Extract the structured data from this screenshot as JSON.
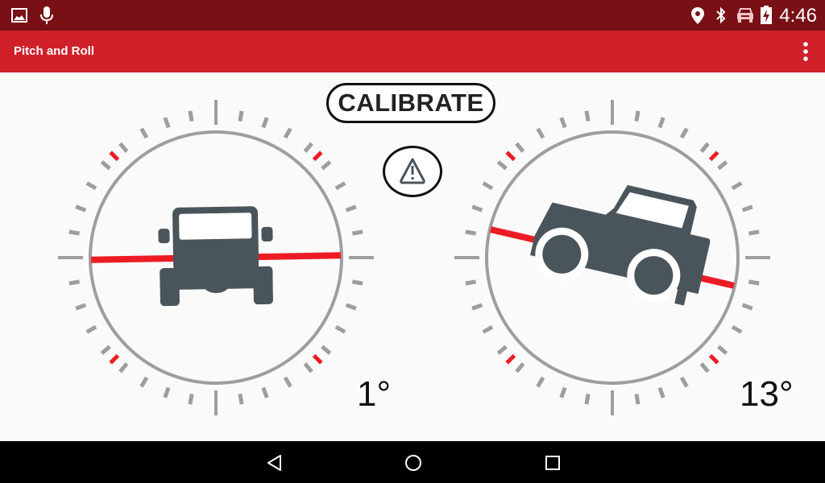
{
  "status_bar": {
    "left_icons": [
      "image-icon",
      "microphone-icon"
    ],
    "right_icons": [
      "location-icon",
      "bluetooth-icon",
      "car-icon",
      "battery-charging-icon"
    ],
    "time": "4:46"
  },
  "app_bar": {
    "title": "Pitch and Roll",
    "menu_icon": "overflow-menu-icon"
  },
  "main": {
    "calibrate_label": "CALIBRATE",
    "warning_icon": "warning-icon",
    "roll_gauge": {
      "angle_deg": 1,
      "display": "1°",
      "vehicle_view": "front"
    },
    "pitch_gauge": {
      "angle_deg": 13,
      "display": "13°",
      "vehicle_view": "side"
    },
    "colors": {
      "accent": "#d0202a",
      "status_bar": "#781016",
      "level_line": "#ed1c24",
      "vehicle": "#4a545b",
      "ring": "#9e9e9e"
    }
  },
  "nav_bar": {
    "buttons": [
      "back",
      "home",
      "recents"
    ]
  }
}
